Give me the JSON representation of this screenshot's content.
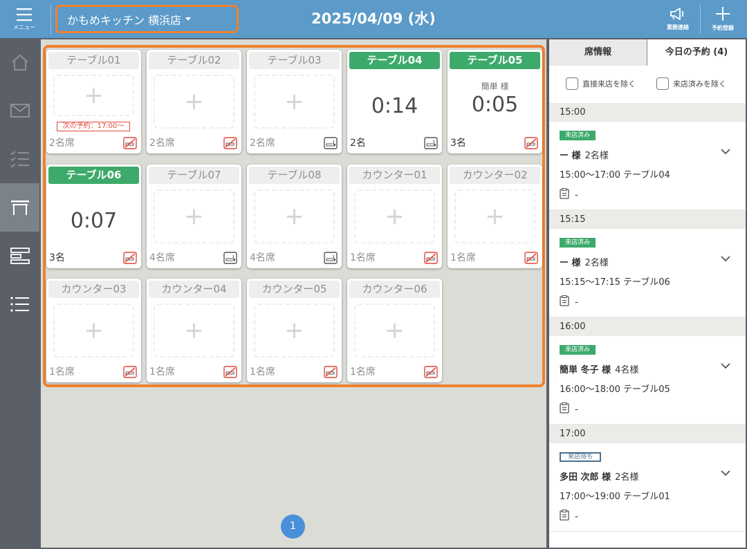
{
  "header": {
    "menu_label": "メニュー",
    "store_name": "かもめキッチン 横浜店",
    "date": "2025/04/09 (水)",
    "notice_label": "業務連絡",
    "add_label": "予約登録"
  },
  "tables": [
    {
      "name": "テーブル01",
      "state": "empty",
      "next": "次の予約：17:00～",
      "seats": "2名席",
      "smoking": false
    },
    {
      "name": "テーブル02",
      "state": "empty",
      "seats": "2名席",
      "smoking": false
    },
    {
      "name": "テーブル03",
      "state": "empty",
      "seats": "2名席",
      "smoking": true
    },
    {
      "name": "テーブル04",
      "state": "busy",
      "timer": "0:14",
      "seats": "2名",
      "smoking": true
    },
    {
      "name": "テーブル05",
      "state": "busy",
      "guest": "簡単 様",
      "timer": "0:05",
      "seats": "3名",
      "smoking": false
    },
    {
      "name": "テーブル06",
      "state": "busy",
      "timer": "0:07",
      "seats": "3名",
      "smoking": false
    },
    {
      "name": "テーブル07",
      "state": "empty",
      "seats": "4名席",
      "smoking": true
    },
    {
      "name": "テーブル08",
      "state": "empty",
      "seats": "4名席",
      "smoking": true
    },
    {
      "name": "カウンター01",
      "state": "empty",
      "seats": "1名席",
      "smoking": false
    },
    {
      "name": "カウンター02",
      "state": "empty",
      "seats": "1名席",
      "smoking": false
    },
    {
      "name": "カウンター03",
      "state": "empty",
      "seats": "1名席",
      "smoking": false
    },
    {
      "name": "カウンター04",
      "state": "empty",
      "seats": "1名席",
      "smoking": false
    },
    {
      "name": "カウンター05",
      "state": "empty",
      "seats": "1名席",
      "smoking": false
    },
    {
      "name": "カウンター06",
      "state": "empty",
      "seats": "1名席",
      "smoking": false
    }
  ],
  "pager": {
    "current": "1"
  },
  "panel": {
    "tab_seat": "席情報",
    "tab_today": "今日の予約 (4)",
    "filter_direct": "直接来店を除く",
    "filter_visited": "来店済みを除く",
    "reservations": [
      {
        "time": "15:00",
        "status": "来店済み",
        "status_type": "done",
        "guest": "ー 様",
        "count": "2名様",
        "detail": "15:00～17:00 テーブル04",
        "memo": "-"
      },
      {
        "time": "15:15",
        "status": "来店済み",
        "status_type": "done",
        "guest": "ー 様",
        "count": "2名様",
        "detail": "15:15～17:15 テーブル06",
        "memo": "-"
      },
      {
        "time": "16:00",
        "status": "来店済み",
        "status_type": "done",
        "guest": "簡単 冬子 様",
        "count": "4名様",
        "detail": "16:00～18:00 テーブル05",
        "memo": "-"
      },
      {
        "time": "17:00",
        "status": "来店待ち",
        "status_type": "wait",
        "guest": "多田 次郎 様",
        "count": "2名様",
        "detail": "17:00～19:00 テーブル01",
        "memo": "-"
      }
    ]
  },
  "colors": {
    "accent": "#f0812d",
    "header": "#5b9ac9",
    "busy": "#3daa6b",
    "warn": "#e2463a"
  }
}
